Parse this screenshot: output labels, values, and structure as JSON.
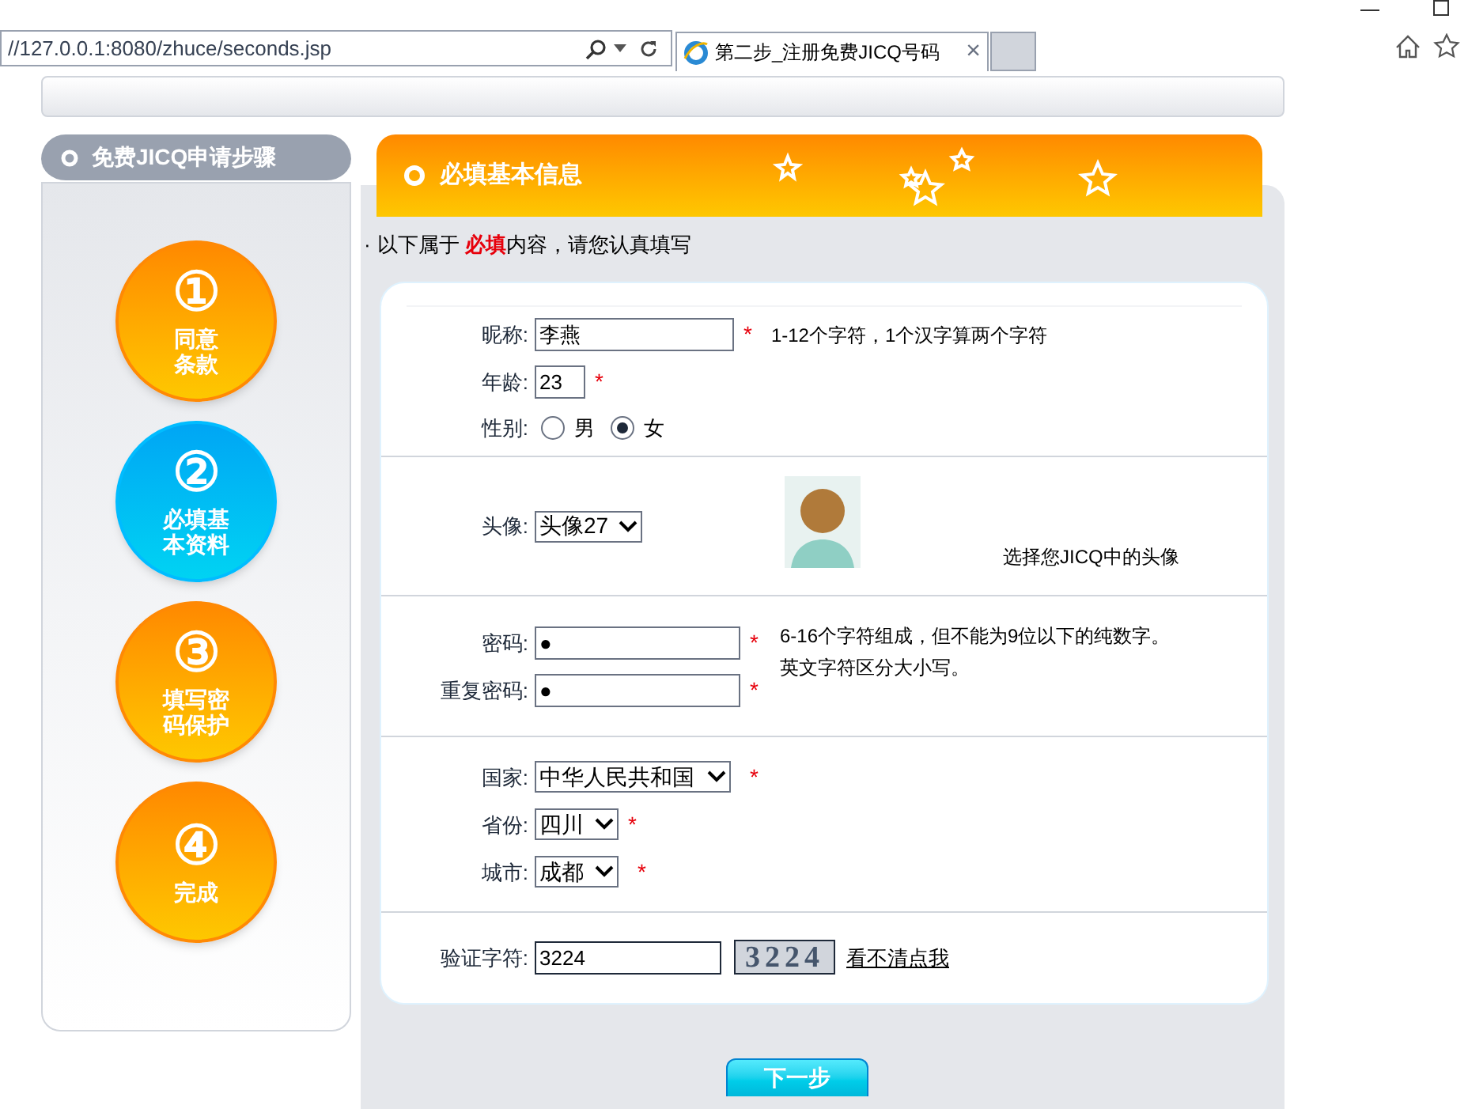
{
  "browser": {
    "address": "//127.0.0.1:8080/zhuce/seconds.jsp",
    "tabs": [
      {
        "title": "第二步_注册免费JICQ号码",
        "selected": true,
        "close": "×"
      }
    ]
  },
  "sidebar": {
    "title": "免费JICQ申请步骤",
    "steps": [
      {
        "number": "①",
        "label_lines": [
          "同意",
          "条款"
        ],
        "selected": false
      },
      {
        "number": "②",
        "label_lines": [
          "必填基",
          "本资料"
        ],
        "selected": true
      },
      {
        "number": "③",
        "label_lines": [
          "填写密",
          "码保护"
        ],
        "selected": false
      },
      {
        "number": "④",
        "label_lines": [
          "完成"
        ],
        "selected": false
      }
    ]
  },
  "panel": {
    "title": "必填基本信息",
    "intro_bullet": "·",
    "intro": "以下属于 **必填**内容，请您认真填写"
  },
  "sections": [
    {
      "rows": [
        {
          "kind": "text",
          "label": "昵称:",
          "value": "李燕",
          "required_mark": "*",
          "hint": "1-12个字符，1个汉字算两个字符"
        },
        {
          "kind": "short_text",
          "label": "年龄:",
          "value": "23",
          "required_mark": "*"
        },
        {
          "kind": "radio",
          "label": "性别:",
          "options": [
            {
              "label": "男",
              "selected": false
            },
            {
              "label": "女",
              "selected": true
            }
          ]
        }
      ]
    },
    {
      "rows": [
        {
          "kind": "avatar",
          "label": "头像:",
          "value": "头像27",
          "caption": "选择您JICQ中的头像"
        }
      ]
    },
    {
      "rows": [
        {
          "kind": "password",
          "label": "密码:",
          "value": "●",
          "required_mark": "*",
          "hint_lines": [
            "6-16个字符组成，但不能为9位以下的纯数字。",
            "英文字符区分大小写。"
          ]
        },
        {
          "kind": "password",
          "label": "重复密码:",
          "value": "●",
          "required_mark": "*"
        }
      ]
    },
    {
      "rows": [
        {
          "kind": "select",
          "label": "国家:",
          "value": "中华人民共和国",
          "required_mark": "*"
        },
        {
          "kind": "select",
          "label": "省份:",
          "value": "四川",
          "required_mark": "*"
        },
        {
          "kind": "select",
          "label": "城市:",
          "value": "成都",
          "required_mark": "*"
        }
      ]
    },
    {
      "rows": [
        {
          "kind": "captcha",
          "label": "验证字符:",
          "value": "3224",
          "captcha_text": "3224",
          "link": "看不清点我"
        }
      ]
    }
  ],
  "next_button": "下一步"
}
